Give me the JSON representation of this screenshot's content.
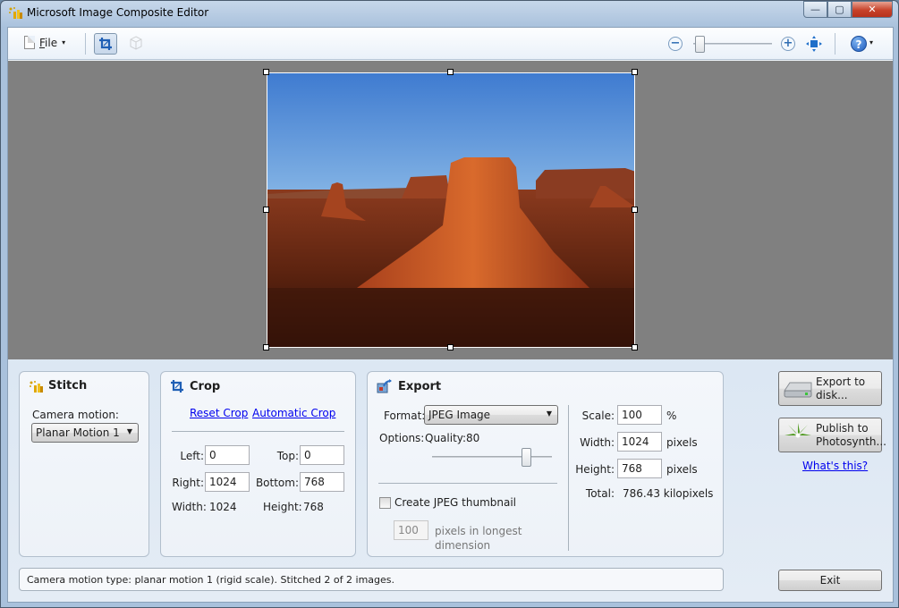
{
  "window": {
    "title": "Microsoft Image Composite Editor",
    "controls": {
      "minimize": "—",
      "maximize": "▢",
      "close": "✕"
    }
  },
  "toolbar": {
    "file_label_accel": "F",
    "file_label_rest": "ile",
    "caret": "▾",
    "zoom_out": "−",
    "zoom_in": "+",
    "help": "?",
    "help_caret": "▾",
    "zoom_level_fraction": 0.05
  },
  "stitch": {
    "title": "Stitch",
    "camera_motion_label": "Camera motion:",
    "camera_motion_value": "Planar Motion 1",
    "dropdown_caret": "▼"
  },
  "crop": {
    "title": "Crop",
    "reset_link": "Reset Crop",
    "auto_link": "Automatic Crop",
    "left_label": "Left:",
    "left_value": "0",
    "top_label": "Top:",
    "top_value": "0",
    "right_label": "Right:",
    "right_value": "1024",
    "bottom_label": "Bottom:",
    "bottom_value": "768",
    "width_label": "Width:",
    "width_value": "1024",
    "height_label": "Height:",
    "height_value": "768"
  },
  "export": {
    "title": "Export",
    "format_label": "Format:",
    "format_value": "JPEG Image",
    "dropdown_caret": "▼",
    "options_label": "Options:",
    "quality_label": "Quality:",
    "quality_value": "80",
    "thumbnail_label": "Create JPEG thumbnail",
    "thumbnail_checked": false,
    "thumbnail_size": "100",
    "thumbnail_desc_1": "pixels in longest",
    "thumbnail_desc_2": "dimension",
    "scale_label": "Scale:",
    "scale_value": "100",
    "scale_unit": "%",
    "width_label": "Width:",
    "width_value": "1024",
    "width_unit": "pixels",
    "height_label": "Height:",
    "height_value": "768",
    "height_unit": "pixels",
    "total_label": "Total:",
    "total_value": "786.43 kilopixels"
  },
  "actions": {
    "export_disk_line1": "Export to",
    "export_disk_line2": "disk...",
    "publish_line1": "Publish to",
    "publish_line2": "Photosynth...",
    "whats_this": "What's this?",
    "exit": "Exit"
  },
  "status": {
    "text": "Camera motion type: planar motion 1 (rigid scale). Stitched 2 of 2 images."
  }
}
